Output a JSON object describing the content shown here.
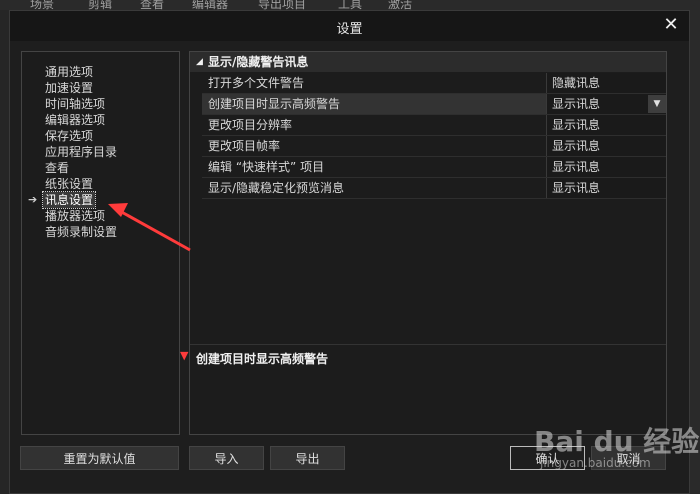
{
  "background": {
    "menubar": [
      "场景",
      "剪辑",
      "查看",
      "编辑器",
      "导出项目",
      "工具",
      "激活"
    ]
  },
  "dialog": {
    "title": "设置",
    "close_symbol": "✕"
  },
  "nav": {
    "items": [
      "通用选项",
      "加速设置",
      "时间轴选项",
      "编辑器选项",
      "保存选项",
      "应用程序目录",
      "查看",
      "纸张设置",
      "讯息设置",
      "播放器选项",
      "音频录制设置"
    ],
    "selected": "讯息设置"
  },
  "section": {
    "title": "显示/隐藏警告讯息",
    "rows": [
      {
        "name": "打开多个文件警告",
        "value": "隐藏讯息"
      },
      {
        "name": "创建项目时显示高频警告",
        "value": "显示讯息"
      },
      {
        "name": "更改项目分辨率",
        "value": "显示讯息"
      },
      {
        "name": "更改项目帧率",
        "value": "显示讯息"
      },
      {
        "name": "编辑 “快速样式” 项目",
        "value": "显示讯息"
      },
      {
        "name": "显示/隐藏稳定化预览消息",
        "value": "显示讯息"
      }
    ]
  },
  "description": {
    "title": "创建项目时显示高频警告"
  },
  "buttons": {
    "reset": "重置为默认值",
    "import": "导入",
    "export": "导出",
    "ok": "确认",
    "cancel": "取消"
  },
  "watermark": {
    "text": "Bai du 经验",
    "sub": "jingyan.baidu.com"
  },
  "colors": {
    "annotation_red": "#ff3b3b"
  }
}
